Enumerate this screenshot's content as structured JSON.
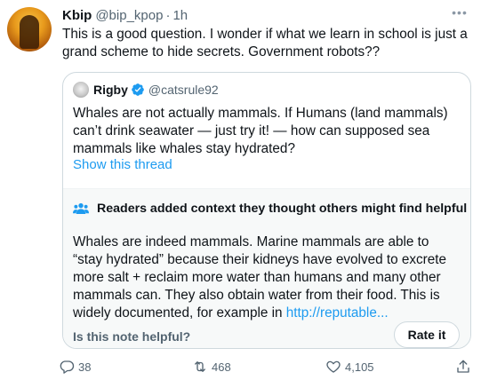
{
  "tweet": {
    "author_name": "Kbip",
    "handle": "@bip_kpop",
    "separator": "·",
    "time": "1h",
    "more_label": "•••",
    "text": "This is a good question. I wonder if what we learn in school is just a grand scheme to hide secrets. Government robots??"
  },
  "quoted": {
    "author_name": "Rigby",
    "handle": "@catsrule92",
    "text": "Whales are not actually mammals. If Humans (land mammals) can’t drink seawater — just try it! — how can supposed sea mammals like whales stay hydrated?",
    "show_thread": "Show this thread"
  },
  "community_note": {
    "title": "Readers added context they thought others might find helpful",
    "body": "Whales are indeed mammals. Marine mammals are able to “stay hydrated” because their kidneys have evolved to excrete more salt + reclaim more water than humans and many other mammals can. They also obtain water from their food. This is widely documented, for example in ",
    "link": "http://reputable...",
    "question": "Is this note helpful?",
    "rate_label": "Rate it"
  },
  "actions": {
    "replies": "38",
    "retweets": "468",
    "likes": "4,105"
  },
  "colors": {
    "link": "#1d9bf0",
    "secondary_text": "#536471",
    "note_background": "#f7f9f9",
    "verified_badge": "#1d9bf0"
  },
  "icons": [
    "author-avatar",
    "verified-badge-icon",
    "people-icon",
    "reply-icon",
    "retweet-icon",
    "like-icon",
    "share-icon",
    "more-icon"
  ]
}
